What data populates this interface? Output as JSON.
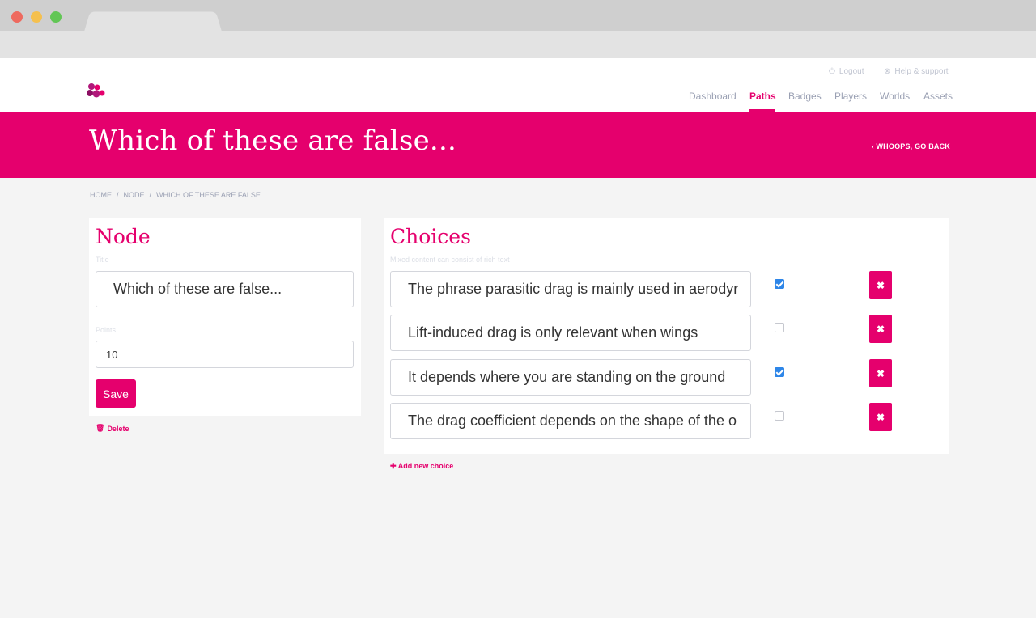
{
  "header": {
    "logout_label": "Logout",
    "help_label": "Help & support",
    "nav": [
      "Dashboard",
      "Paths",
      "Badges",
      "Players",
      "Worlds",
      "Assets"
    ],
    "active_nav": "Paths"
  },
  "hero": {
    "title": "Which of these are false...",
    "back_label": "WHOOPS, GO BACK"
  },
  "breadcrumb": [
    "HOME",
    "NODE",
    "WHICH OF THESE ARE FALSE..."
  ],
  "node_panel": {
    "heading": "Node",
    "title_label": "Title",
    "title_value": "Which of these are false...",
    "points_label": "Points",
    "points_value": "10",
    "save_label": "Save",
    "delete_label": "Delete"
  },
  "choices_panel": {
    "heading": "Choices",
    "hint": "Mixed content can consist of rich text",
    "items": [
      {
        "text": "The phrase parasitic drag is mainly used in aerodyr",
        "checked": true
      },
      {
        "text": "Lift-induced drag is only relevant when wings",
        "checked": false
      },
      {
        "text": "It depends where you are standing on the ground",
        "checked": true
      },
      {
        "text": "The drag coefficient depends on the shape of the o",
        "checked": false
      }
    ],
    "remove_symbol": "✖",
    "add_label": "Add new choice"
  },
  "colors": {
    "accent": "#e5006d",
    "checkbox": "#2e86e8",
    "muted": "#9aa0b3"
  }
}
